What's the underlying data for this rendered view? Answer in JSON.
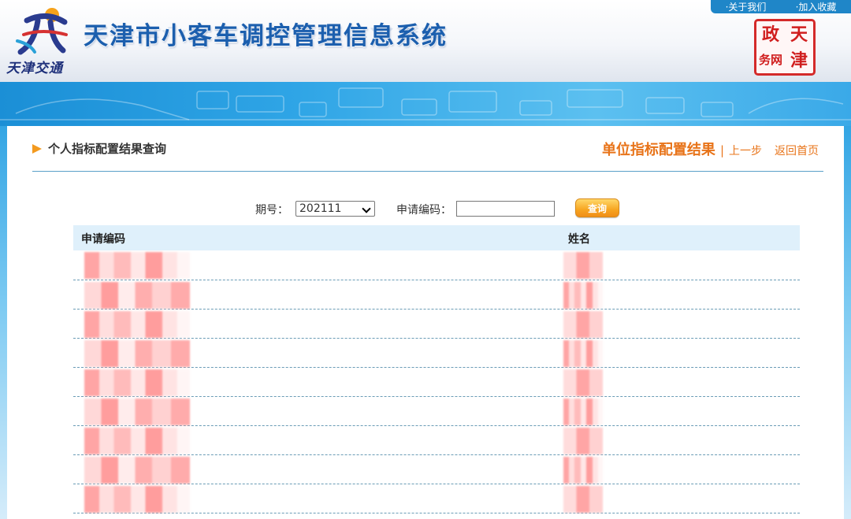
{
  "header": {
    "top_links": [
      "·关于我们",
      "·加入收藏"
    ],
    "logo_text": "天津交通",
    "site_title": "天津市小客车调控管理信息系统",
    "seal_chars": [
      "天",
      "津",
      "政",
      "务网"
    ]
  },
  "page": {
    "heading": "个人指标配置结果查询",
    "result_title": "单位指标配置结果",
    "separator": "|",
    "nav_links": [
      "上一步",
      "返回首页"
    ]
  },
  "form": {
    "period_label": "期号：",
    "period_value": "202111",
    "code_label": "申请编码：",
    "code_value": "",
    "query_button": "查询"
  },
  "table": {
    "columns": [
      "申请编码",
      "姓名"
    ],
    "rows": [
      {
        "code": "",
        "name": ""
      },
      {
        "code": "",
        "name": ""
      },
      {
        "code": "",
        "name": ""
      },
      {
        "code": "",
        "name": ""
      },
      {
        "code": "",
        "name": ""
      },
      {
        "code": "",
        "name": ""
      },
      {
        "code": "",
        "name": ""
      },
      {
        "code": "",
        "name": ""
      },
      {
        "code": "",
        "name": ""
      }
    ]
  },
  "colors": {
    "title_blue": "#1c5fae",
    "accent_orange": "#e8741a",
    "banner_blue": "#2fa5e6",
    "table_header_bg": "#dff0fb"
  }
}
